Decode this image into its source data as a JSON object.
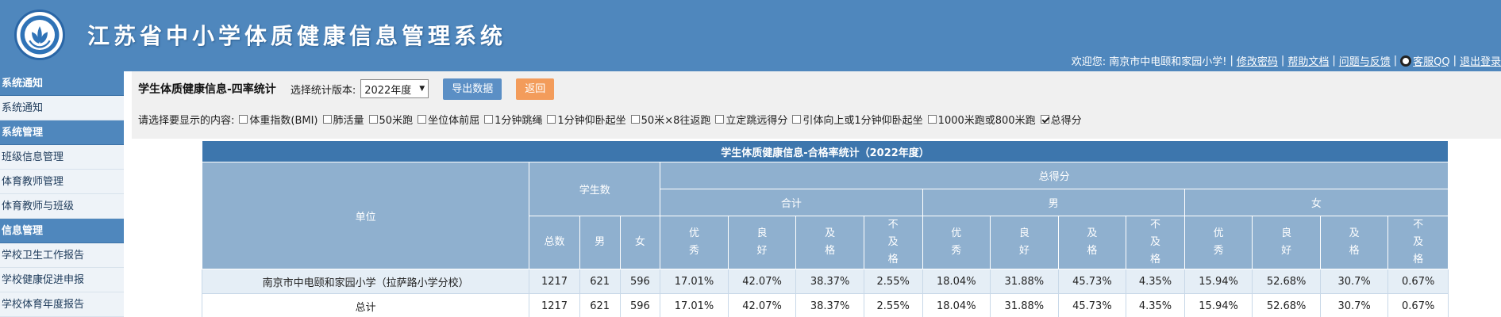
{
  "header": {
    "title": "江苏省中小学体质健康信息管理系统",
    "welcome": "欢迎您: 南京市中电颐和家园小学!",
    "links": [
      "修改密码",
      "帮助文档",
      "问题与反馈",
      "客服QQ",
      "退出登录"
    ]
  },
  "sidebar": {
    "items": [
      {
        "label": "系统通知",
        "type": "header"
      },
      {
        "label": "系统通知",
        "type": "item"
      },
      {
        "label": "系统管理",
        "type": "header"
      },
      {
        "label": "班级信息管理",
        "type": "item"
      },
      {
        "label": "体育教师管理",
        "type": "item"
      },
      {
        "label": "体育教师与班级",
        "type": "item"
      },
      {
        "label": "信息管理",
        "type": "header"
      },
      {
        "label": "学校卫生工作报告",
        "type": "item"
      },
      {
        "label": "学校健康促进申报",
        "type": "item"
      },
      {
        "label": "学校体育年度报告",
        "type": "item"
      }
    ]
  },
  "toolbar": {
    "page_title": "学生体质健康信息-四率统计",
    "version_label": "选择统计版本:",
    "version_value": "2022年度",
    "export_label": "导出数据",
    "back_label": "返回",
    "display_label": "请选择要显示的内容:",
    "options": [
      {
        "label": "体重指数(BMI)",
        "checked": false
      },
      {
        "label": "肺活量",
        "checked": false
      },
      {
        "label": "50米跑",
        "checked": false
      },
      {
        "label": "坐位体前屈",
        "checked": false
      },
      {
        "label": "1分钟跳绳",
        "checked": false
      },
      {
        "label": "1分钟仰卧起坐",
        "checked": false
      },
      {
        "label": "50米×8往返跑",
        "checked": false
      },
      {
        "label": "立定跳远得分",
        "checked": false
      },
      {
        "label": "引体向上或1分钟仰卧起坐",
        "checked": false
      },
      {
        "label": "1000米跑或800米跑",
        "checked": false
      },
      {
        "label": "总得分",
        "checked": true
      }
    ]
  },
  "table": {
    "caption": "学生体质健康信息-合格率统计（2022年度）",
    "unit_header": "单位",
    "students_header": "学生数",
    "score_header": "总得分",
    "group_headers": [
      "合计",
      "男",
      "女"
    ],
    "count_headers": [
      "总数",
      "男",
      "女"
    ],
    "rate_headers": [
      "优秀",
      "良好",
      "及格",
      "不及格"
    ],
    "rows": [
      {
        "unit": "南京市中电颐和家园小学（拉萨路小学分校）",
        "values": [
          "1217",
          "621",
          "596",
          "17.01%",
          "42.07%",
          "38.37%",
          "2.55%",
          "18.04%",
          "31.88%",
          "45.73%",
          "4.35%",
          "15.94%",
          "52.68%",
          "30.7%",
          "0.67%"
        ]
      },
      {
        "unit": "总计",
        "values": [
          "1217",
          "621",
          "596",
          "17.01%",
          "42.07%",
          "38.37%",
          "2.55%",
          "18.04%",
          "31.88%",
          "45.73%",
          "4.35%",
          "15.94%",
          "52.68%",
          "30.7%",
          "0.67%"
        ]
      }
    ]
  }
}
